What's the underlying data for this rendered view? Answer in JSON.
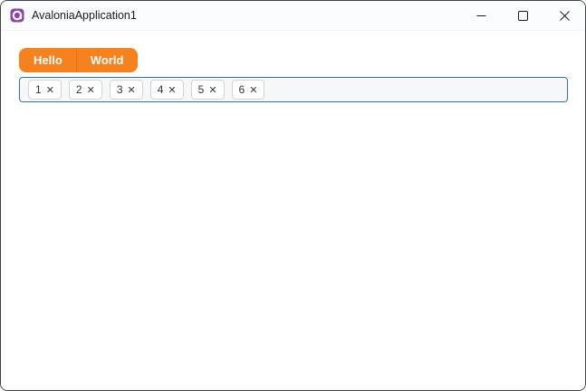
{
  "window": {
    "title": "AvaloniaApplication1",
    "app_icon": "avalonia-logo",
    "controls": {
      "minimize": "minimize-icon",
      "maximize": "maximize-icon",
      "close": "close-icon"
    }
  },
  "toolbar": {
    "buttons": [
      {
        "label": "Hello"
      },
      {
        "label": "World"
      }
    ],
    "accent_color": "#F5821F",
    "divider_color": "#E0720F"
  },
  "tag_box": {
    "chips": [
      {
        "label": "1"
      },
      {
        "label": "2"
      },
      {
        "label": "3"
      },
      {
        "label": "4"
      },
      {
        "label": "5"
      },
      {
        "label": "6"
      }
    ],
    "remove_glyph": "✕",
    "border_color": "#3273A8",
    "background": "#F6F7F8"
  },
  "colors": {
    "window_border": "#424242",
    "titlebar_bg": "#FBFCFD",
    "logo_purple": "#8B44A8",
    "title_text": "#1B1B1B",
    "chip_text": "#333333"
  }
}
